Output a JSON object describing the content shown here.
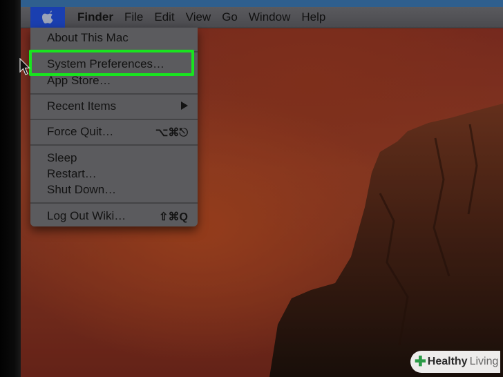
{
  "menubar": {
    "apple_icon": "apple-logo-icon",
    "items": [
      "Finder",
      "File",
      "Edit",
      "View",
      "Go",
      "Window",
      "Help"
    ]
  },
  "apple_menu": {
    "about": "About This Mac",
    "system_preferences": "System Preferences…",
    "app_store": "App Store…",
    "recent_items": "Recent Items",
    "force_quit": "Force Quit…",
    "force_quit_shortcut": "⌥⌘⎋",
    "sleep": "Sleep",
    "restart": "Restart…",
    "shut_down": "Shut Down…",
    "log_out": "Log Out Wiki…",
    "log_out_shortcut": "⇧⌘Q"
  },
  "watermark": {
    "brand_a": "Healthy",
    "brand_b": "Living"
  },
  "colors": {
    "highlight_border": "#19e41f",
    "apple_menu_selected": "#1a3fb0",
    "watermark_green": "#2a9a46"
  }
}
